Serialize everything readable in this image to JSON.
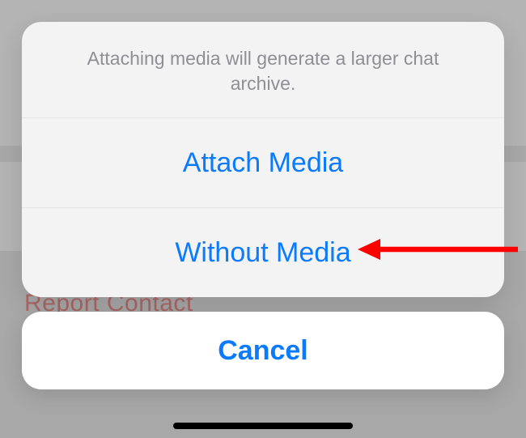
{
  "dialog": {
    "message": "Attaching media will generate a larger chat archive.",
    "actions": {
      "attach": "Attach Media",
      "without": "Without Media"
    },
    "cancel": "Cancel"
  },
  "background": {
    "obscured_text": "Report Contact"
  }
}
